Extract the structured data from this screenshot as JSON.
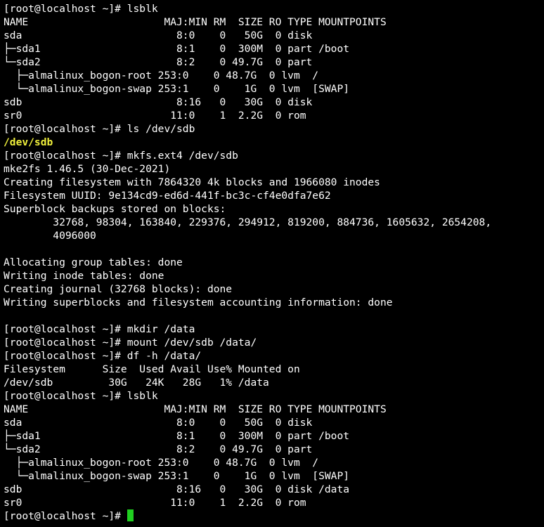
{
  "terminal": {
    "cursor_color": "#20d020",
    "highlight_color": "#f0f03c",
    "lines": [
      "[root@localhost ~]# lsblk",
      "NAME                      MAJ:MIN RM  SIZE RO TYPE MOUNTPOINTS",
      "sda                         8:0    0   50G  0 disk",
      "├─sda1                      8:1    0  300M  0 part /boot",
      "└─sda2                      8:2    0 49.7G  0 part",
      "  ├─almalinux_bogon-root 253:0    0 48.7G  0 lvm  /",
      "  └─almalinux_bogon-swap 253:1    0    1G  0 lvm  [SWAP]",
      "sdb                         8:16   0   30G  0 disk",
      "sr0                        11:0    1  2.2G  0 rom",
      "[root@localhost ~]# ls /dev/sdb",
      "/dev/sdb",
      "[root@localhost ~]# mkfs.ext4 /dev/sdb",
      "mke2fs 1.46.5 (30-Dec-2021)",
      "Creating filesystem with 7864320 4k blocks and 1966080 inodes",
      "Filesystem UUID: 9e134cd9-ed6d-441f-bc3c-cf4e0dfa7e62",
      "Superblock backups stored on blocks:",
      "        32768, 98304, 163840, 229376, 294912, 819200, 884736, 1605632, 2654208,",
      "        4096000",
      "",
      "Allocating group tables: done",
      "Writing inode tables: done",
      "Creating journal (32768 blocks): done",
      "Writing superblocks and filesystem accounting information: done",
      "",
      "[root@localhost ~]# mkdir /data",
      "[root@localhost ~]# mount /dev/sdb /data/",
      "[root@localhost ~]# df -h /data/",
      "Filesystem      Size  Used Avail Use% Mounted on",
      "/dev/sdb         30G   24K   28G   1% /data",
      "[root@localhost ~]# lsblk",
      "NAME                      MAJ:MIN RM  SIZE RO TYPE MOUNTPOINTS",
      "sda                         8:0    0   50G  0 disk",
      "├─sda1                      8:1    0  300M  0 part /boot",
      "└─sda2                      8:2    0 49.7G  0 part",
      "  ├─almalinux_bogon-root 253:0    0 48.7G  0 lvm  /",
      "  └─almalinux_bogon-swap 253:1    0    1G  0 lvm  [SWAP]",
      "sdb                         8:16   0   30G  0 disk /data",
      "sr0                        11:0    1  2.2G  0 rom"
    ],
    "prompt": "[root@localhost ~]# "
  }
}
